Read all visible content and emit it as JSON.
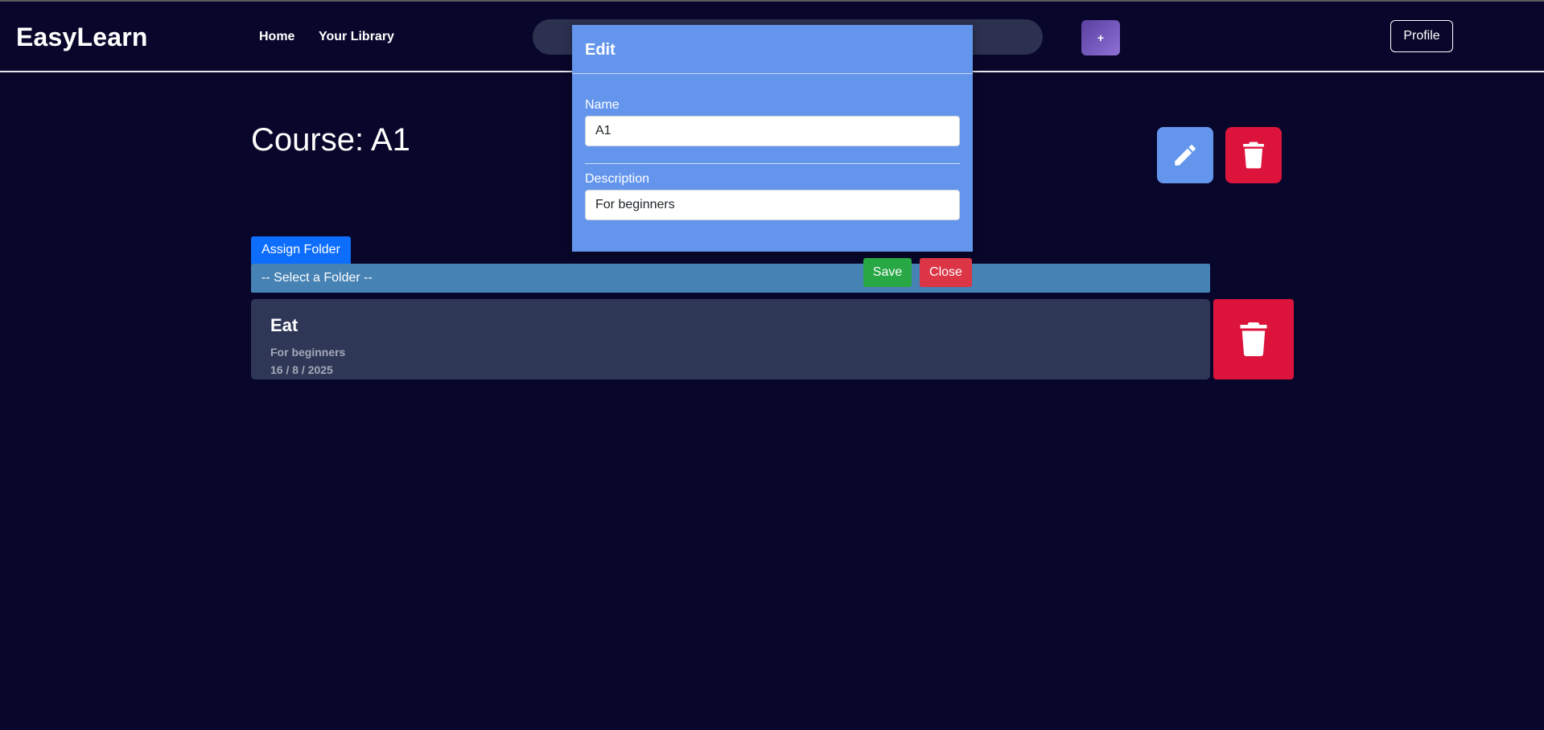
{
  "header": {
    "brand": "EasyLearn",
    "nav": {
      "home": "Home",
      "library": "Your Library"
    },
    "add_label": "+",
    "profile_label": "Profile"
  },
  "course": {
    "title": "Course: A1"
  },
  "folder": {
    "assign_label": "Assign Folder",
    "select_placeholder": "-- Select a Folder --"
  },
  "lessons": [
    {
      "name": "Eat",
      "description": "For beginners",
      "date": "16 / 8 / 2025"
    }
  ],
  "modal": {
    "title": "Edit",
    "name_label": "Name",
    "name_value": "A1",
    "description_label": "Description",
    "description_value": "For beginners",
    "save_label": "Save",
    "close_label": "Close"
  },
  "colors": {
    "background": "#08072b",
    "modal": "#6495ed",
    "edit": "#6495ed",
    "delete": "#dc143c",
    "save": "#28a745",
    "close": "#dc3545",
    "assign": "#0d6efd",
    "select": "#4682b4"
  },
  "icons": {
    "edit": "pencil-icon",
    "delete": "trash-icon"
  }
}
